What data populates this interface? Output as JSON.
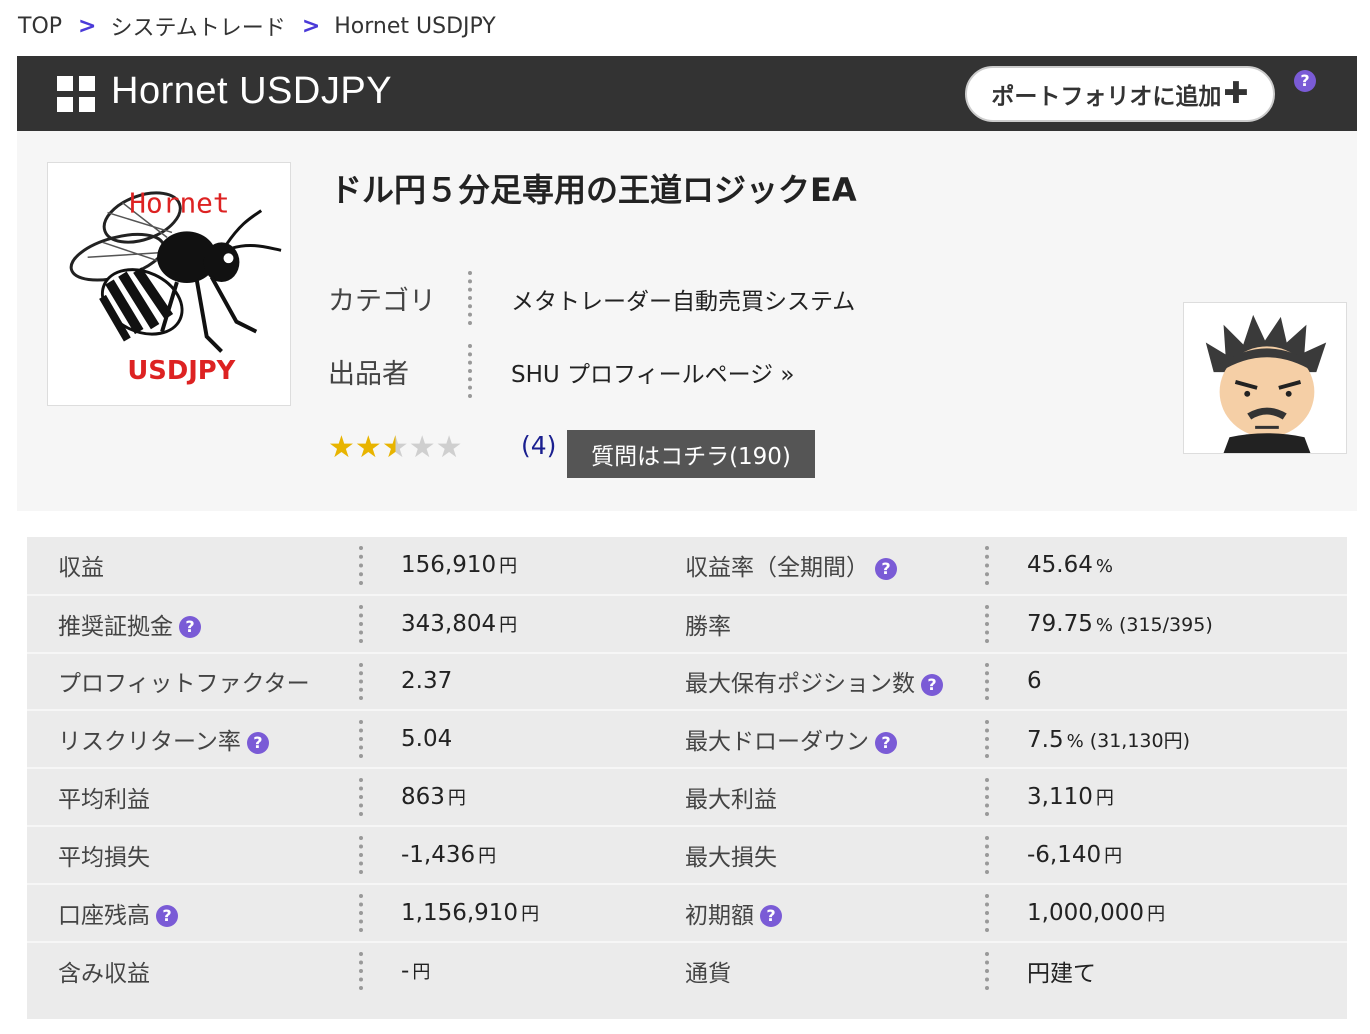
{
  "breadcrumb": {
    "items": [
      "TOP",
      "システムトレード",
      "Hornet USDJPY"
    ],
    "separator": ">"
  },
  "header": {
    "title": "Hornet USDJPY",
    "portfolio_button": "ポートフォリオに追加",
    "portfolio_plus": "✚",
    "help": "?"
  },
  "product": {
    "image_text_top": "Hornet",
    "image_text_bottom": "USDJPY",
    "title": "ドル円５分足専用の王道ロジックEA",
    "category_label": "カテゴリ",
    "category_value": "メタトレーダー自動売買システム",
    "seller_label": "出品者",
    "seller_value": "SHU プロフィールページ »",
    "rating": 2.5,
    "rating_max": 5,
    "rating_count": "(4)",
    "qa_button": "質問はコチラ(190)"
  },
  "stats": {
    "help": "?",
    "rows": [
      {
        "l1": "収益",
        "v1": "156,910",
        "u1": "円",
        "e1": "",
        "l2": "収益率（全期間）",
        "h2": true,
        "v2": "45.64",
        "u2": "%",
        "e2": ""
      },
      {
        "l1": "推奨証拠金",
        "h1": true,
        "v1": "343,804",
        "u1": "円",
        "e1": "",
        "l2": "勝率",
        "v2": "79.75",
        "u2": "%",
        "e2": "(315/395)"
      },
      {
        "l1": "プロフィットファクター",
        "v1": "2.37",
        "u1": "",
        "e1": "",
        "l2": "最大保有ポジション数",
        "h2": true,
        "v2": "6",
        "u2": "",
        "e2": ""
      },
      {
        "l1": "リスクリターン率",
        "h1": true,
        "v1": "5.04",
        "u1": "",
        "e1": "",
        "l2": "最大ドローダウン",
        "h2": true,
        "v2": "7.5",
        "u2": "%",
        "e2": "(31,130円)"
      },
      {
        "l1": "平均利益",
        "v1": "863",
        "u1": "円",
        "e1": "",
        "l2": "最大利益",
        "v2": "3,110",
        "u2": "円",
        "e2": ""
      },
      {
        "l1": "平均損失",
        "v1": "-1,436",
        "u1": "円",
        "e1": "",
        "l2": "最大損失",
        "v2": "-6,140",
        "u2": "円",
        "e2": ""
      },
      {
        "l1": "口座残高",
        "h1": true,
        "v1": "1,156,910",
        "u1": "円",
        "e1": "",
        "l2": "初期額",
        "h2": true,
        "v2": "1,000,000",
        "u2": "円",
        "e2": ""
      },
      {
        "l1": "含み収益",
        "v1": "-",
        "u1": "円",
        "e1": "",
        "l2": "通貨",
        "v2": "円建て",
        "u2": "",
        "e2": ""
      }
    ]
  },
  "colors": {
    "header_bg": "#333333",
    "help_icon": "#7a5bd6",
    "breadcrumb_sep": "#4a3ad8",
    "qa_button_bg": "#555555",
    "star": "#e8b400",
    "stats_bg": "#ebebeb"
  }
}
